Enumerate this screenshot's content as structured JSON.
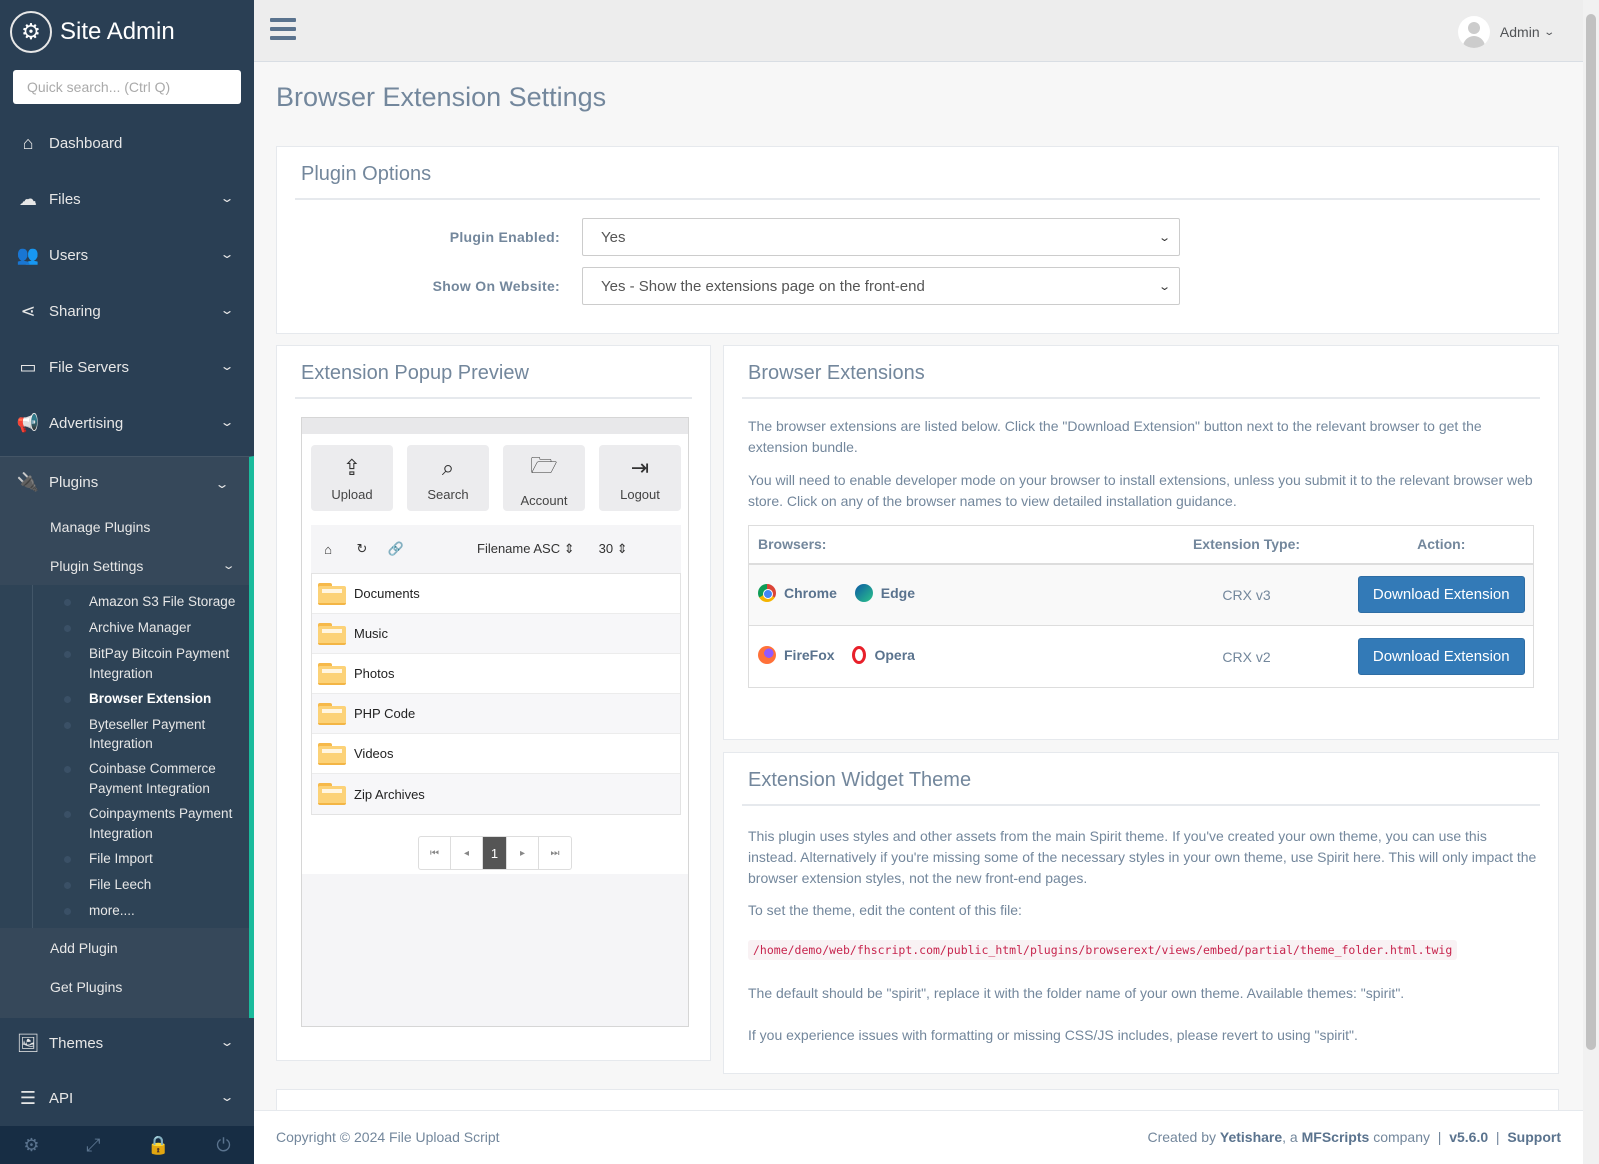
{
  "sidebar": {
    "brand": "Site Admin",
    "search_placeholder": "Quick search... (Ctrl Q)",
    "items": [
      {
        "label": "Dashboard",
        "icon": "home-icon"
      },
      {
        "label": "Files",
        "icon": "cloud-upload-icon"
      },
      {
        "label": "Users",
        "icon": "users-icon"
      },
      {
        "label": "Sharing",
        "icon": "share-icon"
      },
      {
        "label": "File Servers",
        "icon": "hdd-icon"
      },
      {
        "label": "Advertising",
        "icon": "bullhorn-icon"
      }
    ],
    "plugins": {
      "label": "Plugins",
      "manage": "Manage Plugins",
      "settings": "Plugin Settings",
      "settings_items": [
        "Amazon S3 File Storage",
        "Archive Manager",
        "BitPay Bitcoin Payment Integration",
        "Browser Extension",
        "Byteseller Payment Integration",
        "Coinbase Commerce Payment Integration",
        "Coinpayments Payment Integration",
        "File Import",
        "File Leech",
        "more...."
      ],
      "add": "Add Plugin",
      "get": "Get Plugins"
    },
    "themes": "Themes",
    "api": "API"
  },
  "topnav": {
    "user": "Admin"
  },
  "page": {
    "title": "Browser Extension Settings"
  },
  "plugin_options": {
    "title": "Plugin Options",
    "enabled_label": "Plugin Enabled:",
    "enabled_value": "Yes",
    "show_label": "Show On Website:",
    "show_value": "Yes - Show the extensions page on the front-end"
  },
  "preview": {
    "title": "Extension Popup Preview",
    "buttons": [
      "Upload",
      "Search",
      "Account",
      "Logout"
    ],
    "sort": "Filename ASC",
    "per_page": "30",
    "folders": [
      "Documents",
      "Music",
      "Photos",
      "PHP Code",
      "Videos",
      "Zip Archives"
    ],
    "page": "1"
  },
  "extensions": {
    "title": "Browser Extensions",
    "para1": "The browser extensions are listed below. Click the \"Download Extension\" button next to the relevant browser to get the extension bundle.",
    "para2": "You will need to enable developer mode on your browser to install extensions, unless you submit it to the relevant browser web store. Click on any of the browser names to view detailed installation guidance.",
    "col_browsers": "Browsers:",
    "col_type": "Extension Type:",
    "col_action": "Action:",
    "rows": [
      {
        "b1": "Chrome",
        "b2": "Edge",
        "type": "CRX v3",
        "action": "Download Extension"
      },
      {
        "b1": "FireFox",
        "b2": "Opera",
        "type": "CRX v2",
        "action": "Download Extension"
      }
    ]
  },
  "theme": {
    "title": "Extension Widget Theme",
    "para1": "This plugin uses styles and other assets from the main Spirit theme. If you've created your own theme, you can use this instead. Alternatively if you're missing some of the necessary styles in your own theme, use Spirit here. This will only impact the browser extension styles, not the new front-end pages.",
    "para2": "To set the theme, edit the content of this file:",
    "path": "/home/demo/web/fhscript.com/public_html/plugins/browserext/views/embed/partial/theme_folder.html.twig",
    "para3": "The default should be \"spirit\", replace it with the folder name of your own theme. Available themes: \"spirit\".",
    "para4": "If you experience issues with formatting or missing CSS/JS includes, please revert to using \"spirit\"."
  },
  "footer": {
    "copyright": "Copyright © 2024 File Upload Script",
    "created_by": "Created by",
    "yetishare": "Yetishare",
    "a": ", a",
    "mfscripts": "MFScripts",
    "company": "company",
    "sep": "|",
    "version": "v5.6.0",
    "support": "Support"
  }
}
